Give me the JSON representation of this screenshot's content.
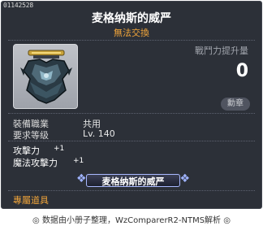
{
  "item": {
    "id": "01142528",
    "name": "麦格纳斯的威严",
    "trade_note": "無法交換",
    "icon_name": "magnus-majesty-medal-icon"
  },
  "power": {
    "label": "戰鬥力提升量",
    "value": "0",
    "medal_button": "勳章"
  },
  "info": [
    {
      "key": "裝備職業",
      "value": "共用"
    },
    {
      "key": "要求等级",
      "value": "Lv. 140"
    }
  ],
  "stats": [
    {
      "key": "攻擊力",
      "value": "+1"
    },
    {
      "key": "魔法攻擊力",
      "value": "+1"
    }
  ],
  "medal_banner": "麦格纳斯的威严",
  "exclusive_label": "專屬道具",
  "footer": "◎ 数据由小册子整理，WzComparerR2-NTMS解析 ◎",
  "colors": {
    "background": "#2c3038",
    "accent": "#f1a53a",
    "text": "#ffffff"
  }
}
